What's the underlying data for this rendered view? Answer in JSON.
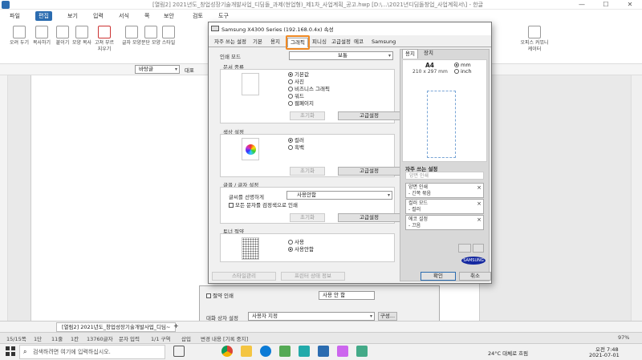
{
  "window": {
    "title": "[열림2] 2021년도_창업성장기술개발사업_디딤돌_과제(현업형)_제1차_사업계획_공고.hwp [D:\\...\\2021년디딤돌창업_사업계획서\\] - 한글",
    "minimize": "—",
    "maximize": "☐",
    "close": "✕"
  },
  "menu": {
    "file": "파일",
    "edit": "편집",
    "view": "보기",
    "insert": "입력",
    "format": "서식",
    "page": "쪽",
    "security": "보안",
    "review": "검토",
    "tools": "도구"
  },
  "ribbon": {
    "items": [
      "오려\n두기",
      "복사하기",
      "오려\n두기",
      "붙이기",
      "모양\n복사",
      "고쳐 부르\n지우기",
      "글자\n모양",
      "문단\n모양",
      "스타일",
      "오피스\n커뮤니케이터"
    ]
  },
  "fmtbar": {
    "style": "바탕글",
    "font": "대표"
  },
  "doc_tab": "[열림2] 2021년도_창업성장기술개발사업_디딤~",
  "statusbar": {
    "page": "15/15쪽",
    "section": "1단",
    "line": "11줄",
    "col": "1칸",
    "chars": "13760글자",
    "lang": "문자 입력",
    "section2": "1/1 구역",
    "insert": "삽입",
    "track": "변경 내용 [기록 중지]",
    "zoom": "97%"
  },
  "taskbar": {
    "search_placeholder": "검색하려면 여기에 입력하십시오.",
    "weather": "24°C  대체로 흐림",
    "time": "오전 7:48",
    "date": "2021-07-01"
  },
  "bg_dialog": {
    "row1_check": "절약 인쇄",
    "row1_value": "사용 안 함",
    "row2_label": "대화 상자 설정",
    "row2_value": "사용자 지정",
    "row2_btn": "구성..."
  },
  "dialog": {
    "title": "Samsung X4300 Series (192.168.0.4x) 속성",
    "tabs": [
      "자주 쓰는 설정",
      "기본",
      "용지",
      "그래픽",
      "피니싱",
      "고급설정",
      "에코",
      "Samsung"
    ],
    "print_mode_label": "인쇄 모드",
    "print_mode_value": "보통",
    "doc_type": {
      "label": "문서 종류",
      "options": [
        "기본값",
        "사진",
        "비즈니스 그래픽",
        "워드",
        "웹페이지"
      ],
      "selected": 0,
      "reset": "초기화",
      "advanced": "고급설정"
    },
    "color_mode": {
      "label": "색상 설정",
      "options": [
        "컬러",
        "흑백"
      ],
      "selected": 0,
      "reset": "초기화",
      "advanced": "고급설정"
    },
    "text": {
      "label": "글꼴 / 글자 설정",
      "sharpen_label": "글씨를 선명하게",
      "sharpen_value": "사용안함",
      "black_text": "모든 문자를 검정색으로 인쇄",
      "reset": "초기화",
      "advanced": "고급설정"
    },
    "toner": {
      "label": "토너 절약",
      "options": [
        "사용",
        "사용안함"
      ],
      "selected": 1
    },
    "bottom": {
      "status": "스타일관리",
      "printer_status": "프린터 상태 정보",
      "ok": "확인",
      "cancel": "취소"
    },
    "preview": {
      "tab_paper": "용지",
      "tab_layout": "장치",
      "paper_size": "A4",
      "paper_dims": "210 x 297 mm",
      "unit_mm": "mm",
      "unit_inch": "inch",
      "favorites_label": "자주 쓰는 설정",
      "favorites_input": "양면 인쇄",
      "favorites": [
        {
          "title": "양면 인쇄",
          "sub": "- 긴쪽 묶음"
        },
        {
          "title": "컬러 모드",
          "sub": "- 컬러"
        },
        {
          "title": "에코 설정",
          "sub": "- 끄음"
        }
      ],
      "brand": "SAMSUNG"
    }
  },
  "colors": {
    "accent": "#2b6cb0",
    "highlight": "#f08a24",
    "samsung_blue": "#1428a0"
  }
}
